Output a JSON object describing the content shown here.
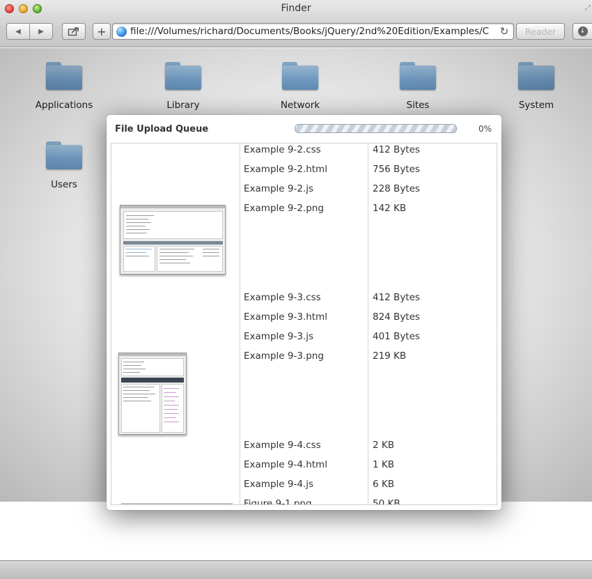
{
  "window": {
    "title": "Finder",
    "url": "file:///Volumes/richard/Documents/Books/jQuery/2nd%20Edition/Examples/C",
    "reader_label": "Reader"
  },
  "folders": [
    {
      "label": "Applications",
      "icon": "folder-icon"
    },
    {
      "label": "Library",
      "icon": "folder-icon"
    },
    {
      "label": "Network",
      "icon": "folder-icon"
    },
    {
      "label": "Sites",
      "icon": "folder-icon"
    },
    {
      "label": "System",
      "icon": "folder-icon"
    },
    {
      "label": "Users",
      "icon": "folder-icon"
    }
  ],
  "upload_dialog": {
    "title": "File Upload Queue",
    "progress_percent": 0,
    "progress_text": "0%",
    "groups": [
      {
        "files": [
          {
            "name": "Example 9-2.css",
            "size": "412 Bytes"
          },
          {
            "name": "Example 9-2.html",
            "size": "756 Bytes"
          },
          {
            "name": "Example 9-2.js",
            "size": "228 Bytes"
          },
          {
            "name": "Example 9-2.png",
            "size": "142 KB"
          }
        ]
      },
      {
        "files": [
          {
            "name": "Example 9-3.css",
            "size": "412 Bytes"
          },
          {
            "name": "Example 9-3.html",
            "size": "824 Bytes"
          },
          {
            "name": "Example 9-3.js",
            "size": "401 Bytes"
          },
          {
            "name": "Example 9-3.png",
            "size": "219 KB"
          }
        ]
      },
      {
        "files": [
          {
            "name": "Example 9-4.css",
            "size": "2 KB"
          },
          {
            "name": "Example 9-4.html",
            "size": "1 KB"
          },
          {
            "name": "Example 9-4.js",
            "size": "6 KB"
          },
          {
            "name": "Figure 9-1.png",
            "size": "50 KB"
          }
        ]
      }
    ]
  },
  "colors": {
    "progress_fill": "#3f86d6",
    "folder_blue": "#7aa7d0"
  }
}
